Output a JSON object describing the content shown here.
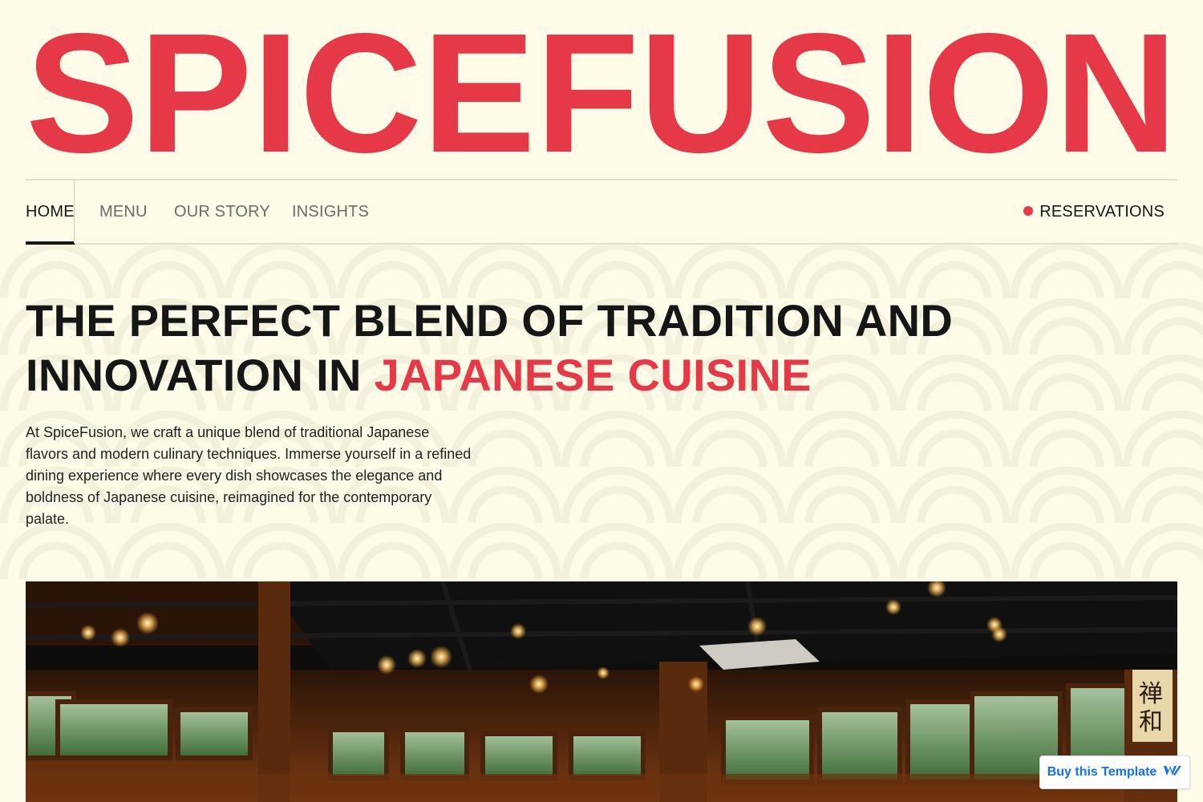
{
  "brand": {
    "logo_text": "SPICEFUSION",
    "accent_color": "#e53947"
  },
  "nav": {
    "items": [
      {
        "label": "HOME",
        "active": true
      },
      {
        "label": "MENU",
        "active": false
      },
      {
        "label": "OUR STORY",
        "active": false
      },
      {
        "label": "INSIGHTS",
        "active": false
      }
    ],
    "reservations_label": "RESERVATIONS"
  },
  "hero": {
    "headline_part1": "THE PERFECT BLEND OF TRADITION AND INNOVATION IN ",
    "headline_accent": "JAPANESE CUISINE",
    "intro": "At SpiceFusion, we craft a unique blend of traditional Japanese flavors and modern culinary techniques. Immerse yourself in a refined dining experience where every dish showcases the elegance and boldness of Japanese cuisine, reimagined for the contemporary palate.",
    "image_icon": "restaurant-interior-photo"
  },
  "badge": {
    "label": "Buy this Template",
    "icon": "webflow-logo-icon"
  },
  "icons": {
    "logo_bowl": "noodle-bowl-icon"
  },
  "colors": {
    "background": "#fefce9",
    "text": "#161616",
    "accent": "#e53947",
    "badge_blue": "#146ef5"
  }
}
